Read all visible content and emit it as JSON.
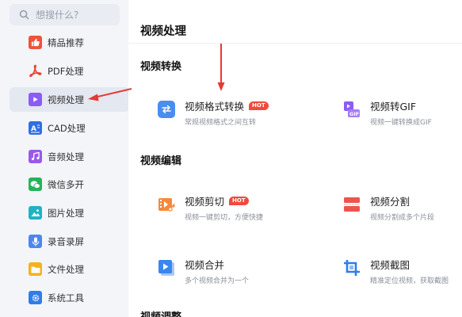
{
  "search": {
    "placeholder": "想搜什么?"
  },
  "sidebar": {
    "items": [
      {
        "label": "精品推荐",
        "icon": "thumbs-up-icon",
        "color": "#f0523a"
      },
      {
        "label": "PDF处理",
        "icon": "pdf-icon",
        "color": "#e8432f"
      },
      {
        "label": "视频处理",
        "icon": "play-icon",
        "color": "#8b5cf6",
        "active": true
      },
      {
        "label": "CAD处理",
        "icon": "cad-icon",
        "color": "#2f6fe4"
      },
      {
        "label": "音频处理",
        "icon": "music-note-icon",
        "color": "#9b59e8"
      },
      {
        "label": "微信多开",
        "icon": "wechat-icon",
        "color": "#25b35a"
      },
      {
        "label": "图片处理",
        "icon": "image-icon",
        "color": "#1fb3c4"
      },
      {
        "label": "录音录屏",
        "icon": "microphone-icon",
        "color": "#4c86f0"
      },
      {
        "label": "文件处理",
        "icon": "folder-icon",
        "color": "#f5b21a"
      },
      {
        "label": "系统工具",
        "icon": "gear-icon",
        "color": "#2f7de8"
      }
    ]
  },
  "main": {
    "title": "视频处理",
    "sections": [
      {
        "title": "视频转换"
      },
      {
        "title": "视频编辑"
      },
      {
        "title": "视频调整"
      }
    ],
    "tools": [
      {
        "name": "视频格式转换",
        "desc": "常规视频格式之间互转",
        "hot": "HOT",
        "icon": "convert-arrows-icon",
        "color": "#4a8df0"
      },
      {
        "name": "视频转GIF",
        "desc": "视频一键转换成GIF",
        "icon": "gif-icon",
        "color": "#8b5cf6"
      },
      {
        "name": "视频剪切",
        "desc": "视频一键剪切，方便快捷",
        "hot": "HOT",
        "icon": "film-scissors-icon",
        "color": "#f58a3c"
      },
      {
        "name": "视频分割",
        "desc": "视频分割成多个片段",
        "icon": "split-icon",
        "color": "#ef5350"
      },
      {
        "name": "视频合并",
        "desc": "多个视频合并为一个",
        "icon": "merge-play-icon",
        "color": "#3a86f0"
      },
      {
        "name": "视频截图",
        "desc": "精准定位视频，获取截图",
        "icon": "crop-icon",
        "color": "#2f7de8"
      }
    ]
  },
  "colors": {
    "annotation_arrow": "#e53935",
    "hot_badge": "#f04a3e"
  }
}
